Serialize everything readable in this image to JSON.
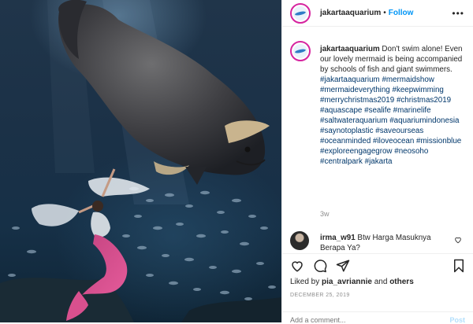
{
  "post": {
    "username": "jakartaaquarium",
    "follow_label": "Follow",
    "more_label": "•••",
    "caption_text": "Don't swim alone! Even our lovely mermaid is being accompanied by schools of fish and giant swimmers.",
    "hashtags": [
      "#jakartaaquarium",
      "#mermaidshow",
      "#mermaideverything",
      "#keepwimming",
      "#merrychristmas2019",
      "#christmas2019",
      "#aquascape",
      "#sealife",
      "#marinelife",
      "#saltwateraquarium",
      "#aquariumindonesia",
      "#saynotoplastic",
      "#saveourseas",
      "#oceanminded",
      "#iloveocean",
      "#missionblue",
      "#exploreengagegrow",
      "#neosoho",
      "#centralpark",
      "#jakarta"
    ],
    "time_ago": "3w",
    "liked_by_prefix": "Liked by",
    "liked_by_user": "pia_avriannie",
    "liked_by_suffix": "and",
    "liked_by_others": "others",
    "date": "DECEMBER 25, 2019",
    "add_comment_placeholder": "Add a comment...",
    "post_button": "Post"
  },
  "comment": {
    "username": "irma_w91",
    "text": "Btw Harga Masuknya Berapa Ya?"
  },
  "icons": {
    "like": "heart-icon",
    "comment": "comment-bubble-icon",
    "share": "paper-plane-icon",
    "save": "bookmark-icon",
    "comment_like": "small-heart-icon",
    "more": "ellipsis-icon"
  },
  "colors": {
    "link_blue": "#0095f6",
    "hashtag": "#00376b",
    "story_ring": "#d6249f",
    "muted": "#8e8e8e"
  }
}
